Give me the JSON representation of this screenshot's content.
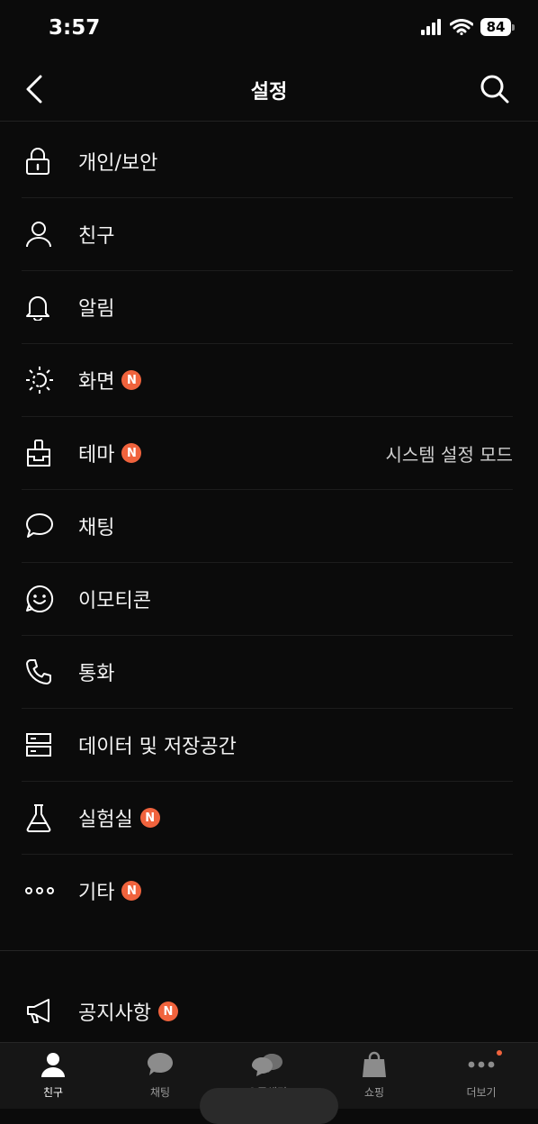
{
  "status_bar": {
    "time": "3:57",
    "battery": "84"
  },
  "header": {
    "title": "설정"
  },
  "menu": [
    {
      "label": "개인/보안",
      "icon": "lock-icon",
      "badge": false,
      "value": ""
    },
    {
      "label": "친구",
      "icon": "person-icon",
      "badge": false,
      "value": ""
    },
    {
      "label": "알림",
      "icon": "bell-icon",
      "badge": false,
      "value": ""
    },
    {
      "label": "화면",
      "icon": "brightness-icon",
      "badge": true,
      "value": ""
    },
    {
      "label": "테마",
      "icon": "theme-brush-icon",
      "badge": true,
      "value": "시스템 설정 모드"
    },
    {
      "label": "채팅",
      "icon": "chat-bubble-icon",
      "badge": false,
      "value": ""
    },
    {
      "label": "이모티콘",
      "icon": "smiley-icon",
      "badge": false,
      "value": ""
    },
    {
      "label": "통화",
      "icon": "phone-icon",
      "badge": false,
      "value": ""
    },
    {
      "label": "데이터 및 저장공간",
      "icon": "storage-icon",
      "badge": false,
      "value": ""
    },
    {
      "label": "실험실",
      "icon": "flask-icon",
      "badge": true,
      "value": ""
    },
    {
      "label": "기타",
      "icon": "more-dots-icon",
      "badge": true,
      "value": ""
    }
  ],
  "notice": {
    "label": "공지사항",
    "icon": "megaphone-icon",
    "badge": true
  },
  "badge_text": "N",
  "tabs": [
    {
      "label": "친구",
      "icon": "friends-tab-icon",
      "active": true
    },
    {
      "label": "채팅",
      "icon": "chat-tab-icon",
      "active": false
    },
    {
      "label": "오픈채팅",
      "icon": "openchat-tab-icon",
      "active": false
    },
    {
      "label": "쇼핑",
      "icon": "shopping-bag-icon",
      "active": false
    },
    {
      "label": "더보기",
      "icon": "more-tab-icon",
      "active": false
    }
  ],
  "colors": {
    "background": "#0b0b0b",
    "accent": "#f0633d",
    "text": "#f2f2f2"
  }
}
